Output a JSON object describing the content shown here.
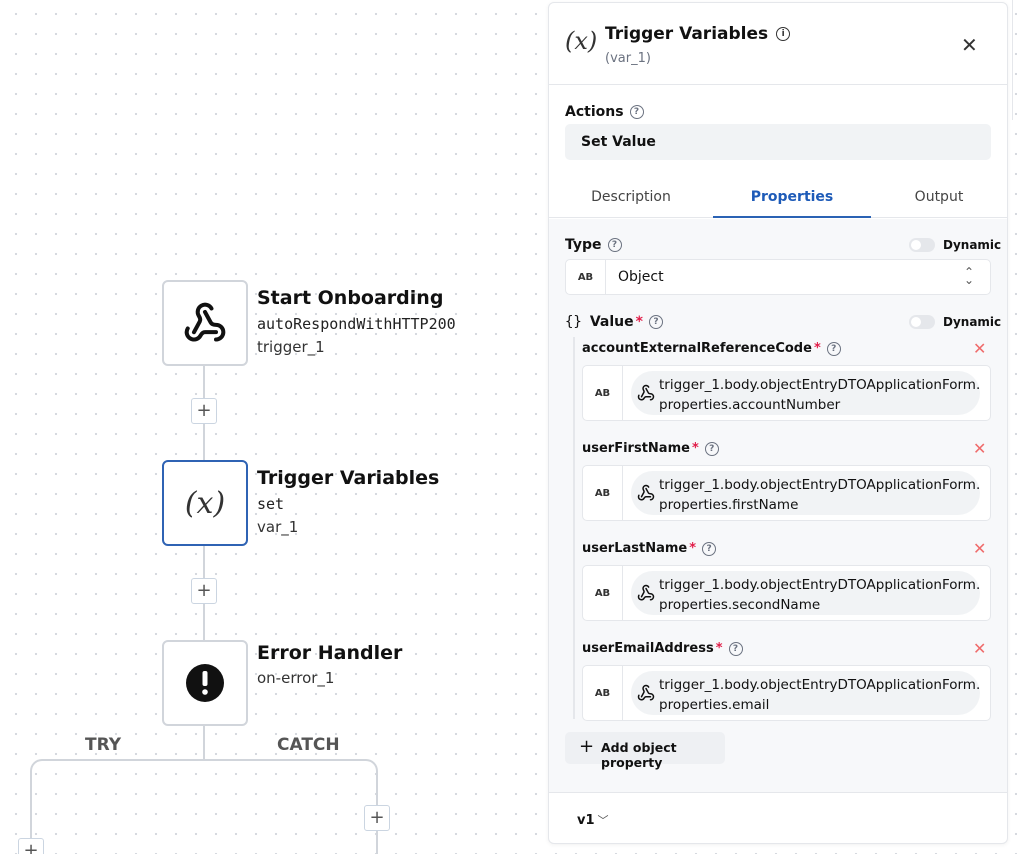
{
  "workflow": {
    "nodes": [
      {
        "title": "Start Onboarding",
        "operation": "autoRespondWithHTTP200",
        "id": "trigger_1",
        "icon": "webhook-icon"
      },
      {
        "title": "Trigger Variables",
        "operation": "set",
        "id": "var_1",
        "icon": "variable-x-icon"
      },
      {
        "title": "Error Handler",
        "id": "on-error_1",
        "icon": "exclamation-circle-icon"
      }
    ],
    "branches": {
      "try_label": "TRY",
      "catch_label": "CATCH"
    }
  },
  "panel": {
    "title": "Trigger Variables",
    "subtitle": "(var_1)",
    "icon_text": "(x)",
    "actions_label": "Actions",
    "action_value": "Set Value",
    "tabs": [
      "Description",
      "Properties",
      "Output"
    ],
    "active_tab": "Properties",
    "type_label": "Type",
    "dynamic_label": "Dynamic",
    "type_badge": "AB",
    "type_value": "Object",
    "value_label": "Value",
    "value_prefix": "{}",
    "properties": [
      {
        "name": "accountExternalReferenceCode",
        "line1": "trigger_1.body.objectEntryDTOApplicationForm.",
        "line2": "properties.accountNumber"
      },
      {
        "name": "userFirstName",
        "line1": "trigger_1.body.objectEntryDTOApplicationForm.",
        "line2": "properties.firstName"
      },
      {
        "name": "userLastName",
        "line1": "trigger_1.body.objectEntryDTOApplicationForm.",
        "line2": "properties.secondName"
      },
      {
        "name": "userEmailAddress",
        "line1": "trigger_1.body.objectEntryDTOApplicationForm.",
        "line2": "properties.email"
      }
    ],
    "add_property_label": "Add object property",
    "version": "v1"
  },
  "colors": {
    "accent": "#2f63b4",
    "required": "#e11d48",
    "remove": "#ef6b6b"
  }
}
